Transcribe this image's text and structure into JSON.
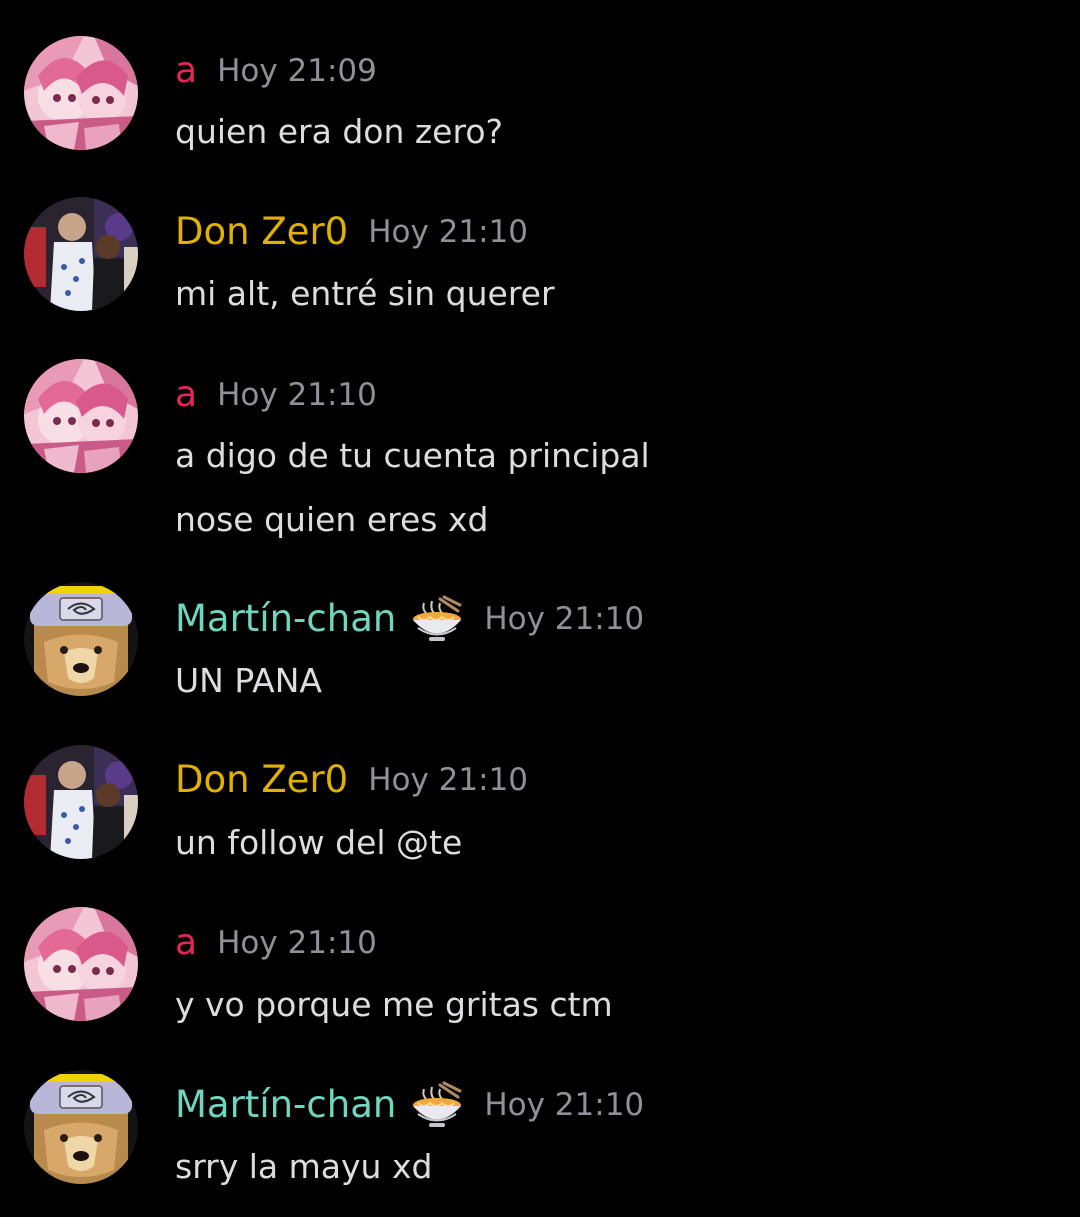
{
  "colors": {
    "background": "#000000",
    "author_a": "#e8245a",
    "author_donzero": "#e2b100",
    "author_martin": "#6fd6c0",
    "timestamp": "#8e9297",
    "text": "#dcddde"
  },
  "messages": [
    {
      "author": "a",
      "time": "Hoy 21:09",
      "lines": [
        "quien era don zero?"
      ]
    },
    {
      "author": "Don Zer0",
      "time": "Hoy 21:10",
      "lines": [
        "mi alt, entré sin querer"
      ]
    },
    {
      "author": "a",
      "time": "Hoy 21:10",
      "lines": [
        "a digo de tu cuenta principal",
        "nose quien eres xd"
      ]
    },
    {
      "author": "Martín-chan",
      "badge": "ramen-bowl-emoji",
      "time": "Hoy 21:10",
      "lines": [
        "UN PANA"
      ]
    },
    {
      "author": "Don Zer0",
      "time": "Hoy 21:10",
      "lines": [
        "un follow del @te"
      ]
    },
    {
      "author": "a",
      "time": "Hoy 21:10",
      "lines": [
        "y vo porque me gritas ctm"
      ]
    },
    {
      "author": "Martín-chan",
      "badge": "ramen-bowl-emoji",
      "time": "Hoy 21:10",
      "lines": [
        "srry la mayu xd"
      ]
    }
  ]
}
